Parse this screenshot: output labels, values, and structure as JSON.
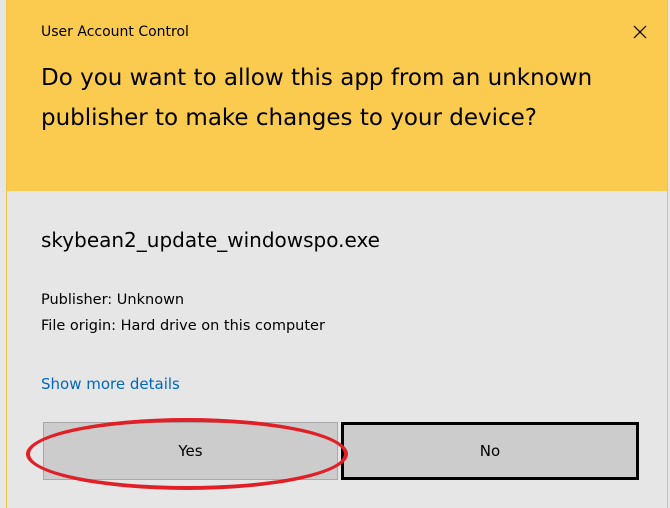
{
  "dialog": {
    "window_title": "User Account Control",
    "question": "Do you want to allow this app from an unknown publisher to make changes to your device?",
    "app_name": "skybean2_update_windowspo.exe",
    "publisher": "Publisher: Unknown",
    "file_origin": "File origin: Hard drive on this computer",
    "details_link": "Show more details",
    "buttons": {
      "yes_label": "Yes",
      "no_label": "No"
    }
  },
  "icons": {
    "close": "close-icon"
  },
  "colors": {
    "header_background": "#fbcb50",
    "body_background": "#e6e6e6",
    "link": "#0067c0",
    "button_background": "#cccccc",
    "highlight_annotation": "#e01f26"
  }
}
